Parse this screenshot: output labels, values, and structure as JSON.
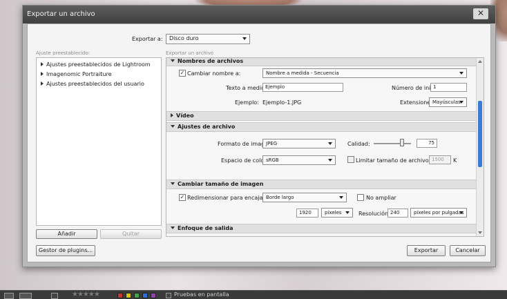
{
  "window": {
    "title": "Exportar un archivo",
    "close_glyph": "✕"
  },
  "export_to": {
    "label": "Exportar a:",
    "value": "Disco duro"
  },
  "presets": {
    "heading": "Ajuste preestablecido:",
    "items": [
      "Ajustes preestablecidos de Lightroom",
      "Imagenomic Portraiture",
      "Ajustes preestablecidos del usuario"
    ],
    "add_label": "Añadir",
    "remove_label": "Quitar"
  },
  "settings_heading": "Exportar un archivo",
  "file_naming": {
    "header": "Nombres de archivos",
    "rename_label": "Cambiar nombre a:",
    "rename_checked": true,
    "rename_value": "Nombre a medida - Secuencia",
    "custom_text_label": "Texto a medida:",
    "custom_text_value": "Ejemplo",
    "start_number_label": "Número de inicio:",
    "start_number_value": "1",
    "example_label": "Ejemplo:",
    "example_value": "Ejemplo-1.JPG",
    "extensions_label": "Extensiones:",
    "extensions_value": "Mayúsculas"
  },
  "video": {
    "header": "Vídeo"
  },
  "file_settings": {
    "header": "Ajustes de archivo",
    "format_label": "Formato de imagen:",
    "format_value": "JPEG",
    "quality_label": "Calidad:",
    "quality_value": "75",
    "quality_fraction": 0.75,
    "color_space_label": "Espacio de color:",
    "color_space_value": "sRGB",
    "limit_size_label": "Limitar tamaño de archivo a:",
    "limit_size_checked": false,
    "limit_size_value": "1500",
    "limit_size_unit": "K"
  },
  "resize": {
    "header": "Cambiar tamaño de imagen",
    "resize_label": "Redimensionar para encajar:",
    "resize_checked": true,
    "resize_value": "Borde largo",
    "no_enlarge_label": "No ampliar",
    "no_enlarge_checked": false,
    "size_value": "1920",
    "size_unit": "píxeles",
    "resolution_label": "Resolución:",
    "resolution_value": "240",
    "resolution_unit": "píxeles por pulgadas"
  },
  "output_sharpening": {
    "header": "Enfoque de salida"
  },
  "footer": {
    "plugins_label": "Gestor de plugins...",
    "export_label": "Exportar",
    "cancel_label": "Cancelar"
  },
  "taskbar": {
    "stars": "★★★★★",
    "label_colors": [
      "#c0392b",
      "#d4c21a",
      "#3fa34d",
      "#2f6fd1",
      "#8e44ad"
    ],
    "proof_label": "Pruebas en pantalla"
  }
}
